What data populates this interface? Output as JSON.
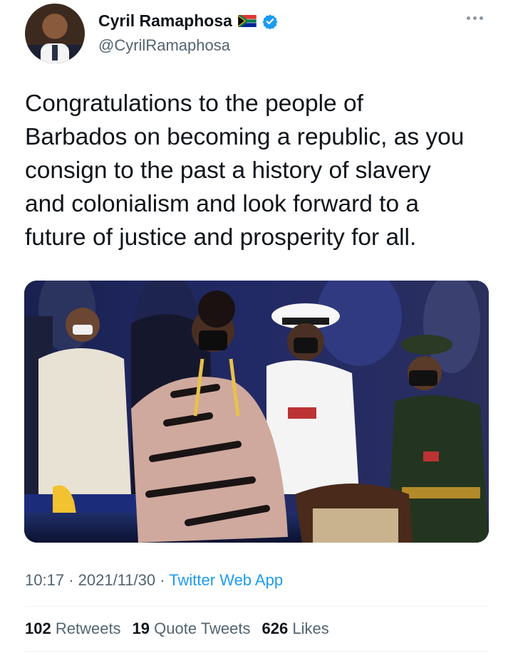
{
  "author": {
    "display_name": "Cyril Ramaphosa",
    "handle": "@CyrilRamaphosa",
    "flag_icon": "south-africa-flag-icon",
    "verified_icon": "verified-badge-icon",
    "verified_color": "#1d9bf0"
  },
  "tweet": {
    "text_lines": [
      "Congratulations to the people of",
      "Barbados on becoming a republic, as you",
      "consign to the past a history of slavery",
      "and colonialism and look forward to a",
      "future of justice and prosperity for all."
    ]
  },
  "meta": {
    "time": "10:17",
    "separator": "·",
    "date": "2021/11/30",
    "app": "Twitter Web App"
  },
  "stats": {
    "retweets_count": "102",
    "retweets_label": "Retweets",
    "quote_count": "19",
    "quote_label": "Quote Tweets",
    "likes_count": "626",
    "likes_label": "Likes"
  }
}
